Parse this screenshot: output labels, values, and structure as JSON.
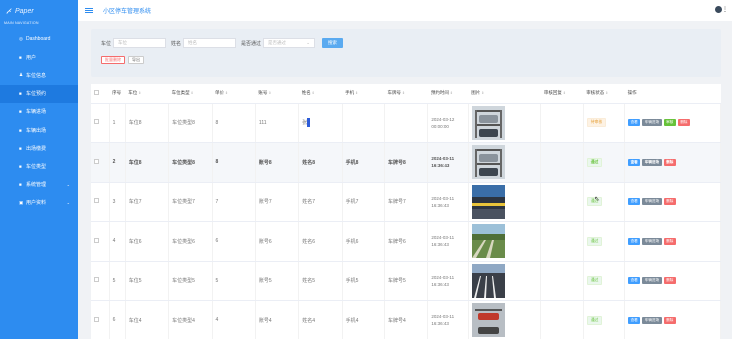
{
  "brand": {
    "logo_text": "Paper"
  },
  "sidebar": {
    "nav_header": "MAIN NAVIGATION",
    "items": [
      {
        "icon": "◎",
        "label": "Dashboard"
      },
      {
        "icon": "■",
        "label": "用户"
      },
      {
        "icon": "♟",
        "label": "车位信息"
      },
      {
        "icon": "■",
        "label": "车位预约"
      },
      {
        "icon": "■",
        "label": "车辆进场"
      },
      {
        "icon": "■",
        "label": "车辆出场"
      },
      {
        "icon": "■",
        "label": "出场缴费"
      },
      {
        "icon": "■",
        "label": "车位类型"
      },
      {
        "icon": "■",
        "label": "系统管理",
        "chevron": "⌄"
      },
      {
        "icon": "▣",
        "label": "用户资料",
        "chevron": "⌄"
      }
    ]
  },
  "topbar": {
    "title": "小区停车管理系统",
    "more": "⋮"
  },
  "filter": {
    "f1_label": "车位",
    "f1_placeholder": "车位",
    "f2_label": "姓名",
    "f2_placeholder": "姓名",
    "f3_label": "是否通过",
    "f3_placeholder": "是否通过",
    "search_btn": "搜索",
    "batch_delete": "批量删除",
    "export": "导出"
  },
  "table": {
    "headers": [
      "序号",
      "车位",
      "车位类型",
      "单价",
      "账号",
      "姓名",
      "手机",
      "车牌号",
      "预约时间",
      "图片",
      "审核回复",
      "审核状态",
      "操作"
    ],
    "sort_icon": "⇕",
    "rows": [
      {
        "no": "1",
        "spot": "车位8",
        "type": "车位类型8",
        "price": "8",
        "account": "111",
        "name": "张",
        "phone": "",
        "plate": "",
        "time": "2024-03-12 00:00:00",
        "reply": "",
        "status": "待审核",
        "status_kind": "pending",
        "ops": [
          "查看",
          "车辆进场",
          "审核",
          "删除"
        ]
      },
      {
        "no": "2",
        "spot": "车位8",
        "type": "车位类型8",
        "price": "8",
        "account": "账号8",
        "name": "姓名8",
        "phone": "手机8",
        "plate": "车牌号8",
        "time": "2024-03-11 16:36:43",
        "reply": "",
        "status": "通过",
        "status_kind": "ok",
        "ops": [
          "查看",
          "车辆进场",
          "删除"
        ]
      },
      {
        "no": "3",
        "spot": "车位7",
        "type": "车位类型7",
        "price": "7",
        "account": "账号7",
        "name": "姓名7",
        "phone": "手机7",
        "plate": "车牌号7",
        "time": "2024-03-11 16:36:43",
        "reply": "",
        "status": "通过",
        "status_kind": "ok",
        "ops": [
          "查看",
          "车辆进场",
          "删除"
        ]
      },
      {
        "no": "4",
        "spot": "车位6",
        "type": "车位类型6",
        "price": "6",
        "account": "账号6",
        "name": "姓名6",
        "phone": "手机6",
        "plate": "车牌号6",
        "time": "2024-03-11 16:36:43",
        "reply": "",
        "status": "通过",
        "status_kind": "ok",
        "ops": [
          "查看",
          "车辆进场",
          "删除"
        ]
      },
      {
        "no": "5",
        "spot": "车位5",
        "type": "车位类型5",
        "price": "5",
        "account": "账号5",
        "name": "姓名5",
        "phone": "手机5",
        "plate": "车牌号5",
        "time": "2024-03-11 16:36:43",
        "reply": "",
        "status": "通过",
        "status_kind": "ok",
        "ops": [
          "查看",
          "车辆进场",
          "删除"
        ]
      },
      {
        "no": "6",
        "spot": "车位4",
        "type": "车位类型4",
        "price": "4",
        "account": "账号4",
        "name": "姓名4",
        "phone": "手机4",
        "plate": "车牌号4",
        "time": "2024-03-11 16:36:43",
        "reply": "",
        "status": "通过",
        "status_kind": "ok",
        "ops": [
          "查看",
          "车辆进场",
          "删除"
        ]
      }
    ],
    "images": [
      "parking-lift",
      "parking-lift",
      "parking-lot-yellow",
      "parking-lot-grass",
      "parking-lot-stripes",
      "parking-lift-car"
    ]
  },
  "colors": {
    "primary": "#2d8cf0",
    "danger": "#f56c6c",
    "success": "#67c23a",
    "warning": "#e6a23c"
  }
}
